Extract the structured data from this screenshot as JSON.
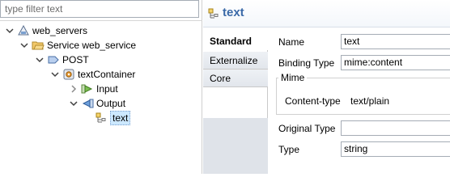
{
  "filter": {
    "placeholder": "type filter text"
  },
  "tree": {
    "web_servers": "web_servers",
    "service": "Service web_service",
    "post": "POST",
    "text_container": "textContainer",
    "input": "Input",
    "output": "Output",
    "text": "text"
  },
  "header": {
    "title": "text"
  },
  "tabs": [
    "Standard",
    "Externalize",
    "Core"
  ],
  "form": {
    "name_label": "Name",
    "name_value": "text",
    "binding_label": "Binding Type",
    "binding_value": "mime:content",
    "mime_group": "Mime",
    "content_type_label": "Content-type",
    "content_type_value": "text/plain",
    "original_type_label": "Original Type",
    "original_type_value": "",
    "type_label": "Type",
    "type_value": "string"
  },
  "colors": {
    "accent": "#3b6aa8",
    "selection": "#cce8ff"
  },
  "icons": {
    "web_servers": "server-triangle-icon",
    "service": "folder-service-icon",
    "post": "arrow-right-icon",
    "text_container": "container-gear-icon",
    "input": "input-arrow-icon",
    "output": "output-arrow-icon",
    "text": "text-element-icon"
  }
}
